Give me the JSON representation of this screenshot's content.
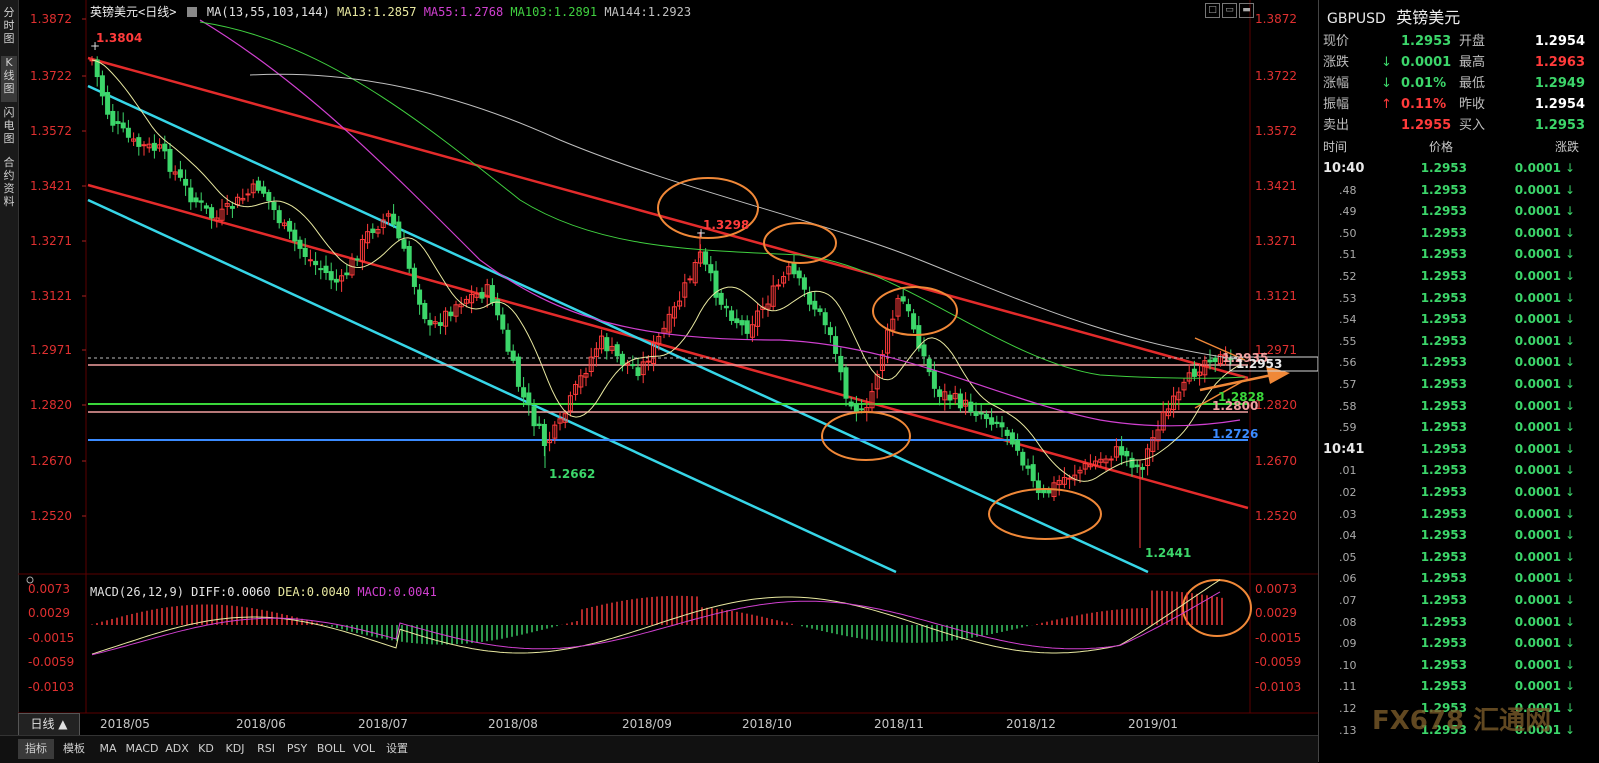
{
  "left_tabs": [
    {
      "label": "分时图",
      "active": false
    },
    {
      "label": "K线图",
      "active": true
    },
    {
      "label": "闪电图",
      "active": false
    },
    {
      "label": "合约资料",
      "active": false
    }
  ],
  "main_title": {
    "name": "英镑美元<日线>",
    "ma_label": "MA(13,55,103,144)",
    "ma13": "MA13:1.2857",
    "ma55": "MA55:1.2768",
    "ma103": "MA103:1.2891",
    "ma144": "MA144:1.2923"
  },
  "macd_title": {
    "label": "MACD(26,12,9)",
    "diff": "DIFF:0.0060",
    "dea": "DEA:0.0040",
    "macd": "MACD:0.0041"
  },
  "colors": {
    "ma13": "#e8e8a0",
    "ma55": "#d040d0",
    "ma103": "#40d040",
    "ma144": "#c0c0c0",
    "up": "#ff3b3b",
    "down": "#3cd66a",
    "red_channel": "#e32b2b",
    "cyan_channel": "#37d6e8",
    "support_green": "#3ad63a",
    "support_pink": "#f2a0a0",
    "support_blue": "#3b8bff",
    "circle": "#f08838"
  },
  "price_axis": [
    "1.3872",
    "1.3722",
    "1.3572",
    "1.3421",
    "1.3271",
    "1.3121",
    "1.2971",
    "1.2820",
    "1.2670",
    "1.2520"
  ],
  "macd_axis": [
    "0.0073",
    "0.0029",
    "-0.0015",
    "-0.0059",
    "-0.0103"
  ],
  "annotations": {
    "high1": "1.3804",
    "high2": "1.3298",
    "low1": "1.2662",
    "low2": "1.2441",
    "lvl_2935": "1.2935",
    "lvl_2828": "1.2828",
    "lvl_2800": "1.2800",
    "lvl_2726": "1.2726",
    "current_box": "1.2953"
  },
  "x_axis": [
    "2018/05",
    "2018/06",
    "2018/07",
    "2018/08",
    "2018/09",
    "2018/10",
    "2018/11",
    "2018/12",
    "2019/01"
  ],
  "day_kline_btn": "日线 ▲",
  "bottom_tabs": [
    "指标",
    "模板",
    "MA",
    "MACD",
    "ADX",
    "KD",
    "KDJ",
    "RSI",
    "PSY",
    "BOLL",
    "VOL",
    "设置"
  ],
  "window_buttons": [
    "□",
    "▭",
    "▬"
  ],
  "quote": {
    "symbol": "GBPUSD",
    "name": "英镑美元",
    "rows": [
      {
        "l1": "现价",
        "v1": "1.2953",
        "c1": "#3cd66a",
        "a1": "",
        "l2": "开盘",
        "v2": "1.2954",
        "c2": "#ffffff"
      },
      {
        "l1": "涨跌",
        "v1": "0.0001",
        "c1": "#3cd66a",
        "a1": "↓",
        "l2": "最高",
        "v2": "1.2963",
        "c2": "#ff3b3b"
      },
      {
        "l1": "涨幅",
        "v1": "0.01%",
        "c1": "#3cd66a",
        "a1": "↓",
        "l2": "最低",
        "v2": "1.2949",
        "c2": "#3cd66a"
      },
      {
        "l1": "振幅",
        "v1": "0.11%",
        "c1": "#ff3b3b",
        "a1": "↑",
        "l2": "昨收",
        "v2": "1.2954",
        "c2": "#ffffff"
      },
      {
        "l1": "卖出",
        "v1": "1.2955",
        "c1": "#ff3b3b",
        "a1": "",
        "l2": "买入",
        "v2": "1.2953",
        "c2": "#3cd66a"
      }
    ]
  },
  "ticks_header": {
    "time": "时间",
    "price": "价格",
    "change": "涨跌"
  },
  "ticks": [
    {
      "t": "10:40",
      "p": "1.2953",
      "c": "0.0001",
      "major": true
    },
    {
      "t": ".48",
      "p": "1.2953",
      "c": "0.0001"
    },
    {
      "t": ".49",
      "p": "1.2953",
      "c": "0.0001"
    },
    {
      "t": ".50",
      "p": "1.2953",
      "c": "0.0001"
    },
    {
      "t": ".51",
      "p": "1.2953",
      "c": "0.0001"
    },
    {
      "t": ".52",
      "p": "1.2953",
      "c": "0.0001"
    },
    {
      "t": ".53",
      "p": "1.2953",
      "c": "0.0001"
    },
    {
      "t": ".54",
      "p": "1.2953",
      "c": "0.0001"
    },
    {
      "t": ".55",
      "p": "1.2953",
      "c": "0.0001"
    },
    {
      "t": ".56",
      "p": "1.2953",
      "c": "0.0001"
    },
    {
      "t": ".57",
      "p": "1.2953",
      "c": "0.0001"
    },
    {
      "t": ".58",
      "p": "1.2953",
      "c": "0.0001"
    },
    {
      "t": ".59",
      "p": "1.2953",
      "c": "0.0001"
    },
    {
      "t": "10:41",
      "p": "1.2953",
      "c": "0.0001",
      "major": true
    },
    {
      "t": ".01",
      "p": "1.2953",
      "c": "0.0001"
    },
    {
      "t": ".02",
      "p": "1.2953",
      "c": "0.0001"
    },
    {
      "t": ".03",
      "p": "1.2953",
      "c": "0.0001"
    },
    {
      "t": ".04",
      "p": "1.2953",
      "c": "0.0001"
    },
    {
      "t": ".05",
      "p": "1.2953",
      "c": "0.0001"
    },
    {
      "t": ".06",
      "p": "1.2953",
      "c": "0.0001"
    },
    {
      "t": ".07",
      "p": "1.2953",
      "c": "0.0001"
    },
    {
      "t": ".08",
      "p": "1.2953",
      "c": "0.0001"
    },
    {
      "t": ".09",
      "p": "1.2953",
      "c": "0.0001"
    },
    {
      "t": ".10",
      "p": "1.2953",
      "c": "0.0001"
    },
    {
      "t": ".11",
      "p": "1.2953",
      "c": "0.0001"
    },
    {
      "t": ".12",
      "p": "1.2953",
      "c": "0.0001"
    },
    {
      "t": ".13",
      "p": "1.2953",
      "c": "0.0001"
    }
  ],
  "watermark": "FX678 汇通网"
}
